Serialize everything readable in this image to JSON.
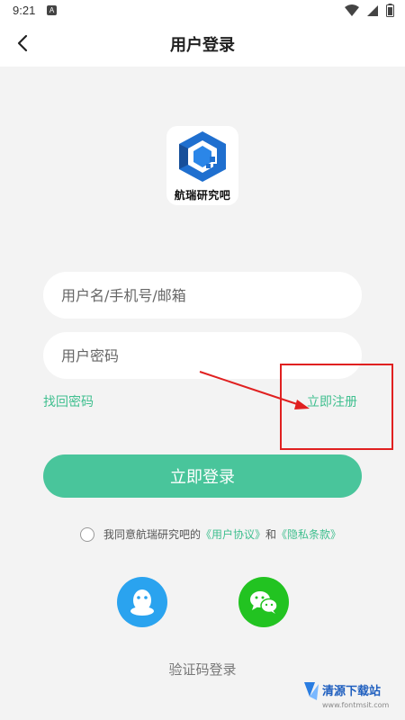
{
  "statusbar": {
    "time": "9:21",
    "badge": "A"
  },
  "header": {
    "title": "用户登录"
  },
  "logo": {
    "text": "航瑞研究吧"
  },
  "form": {
    "username_placeholder": "用户名/手机号/邮箱",
    "password_placeholder": "用户密码",
    "forgot_label": "找回密码",
    "register_label": "立即注册",
    "login_label": "立即登录"
  },
  "agreement": {
    "prefix": "我同意航瑞研究吧的",
    "user_agreement": "《用户协议》",
    "and": "和",
    "privacy": "《隐私条款》"
  },
  "social": {
    "qq": "qq-icon",
    "wechat": "wechat-icon"
  },
  "alt_login": {
    "label": "验证码登录"
  },
  "watermark": {
    "text": "清源下载站",
    "url": "www.fontmsit.com"
  },
  "colors": {
    "accent": "#49c59b",
    "link": "#3fbf8f",
    "qq": "#2aa3ef",
    "wechat": "#22c321",
    "annotation": "#e02020"
  }
}
